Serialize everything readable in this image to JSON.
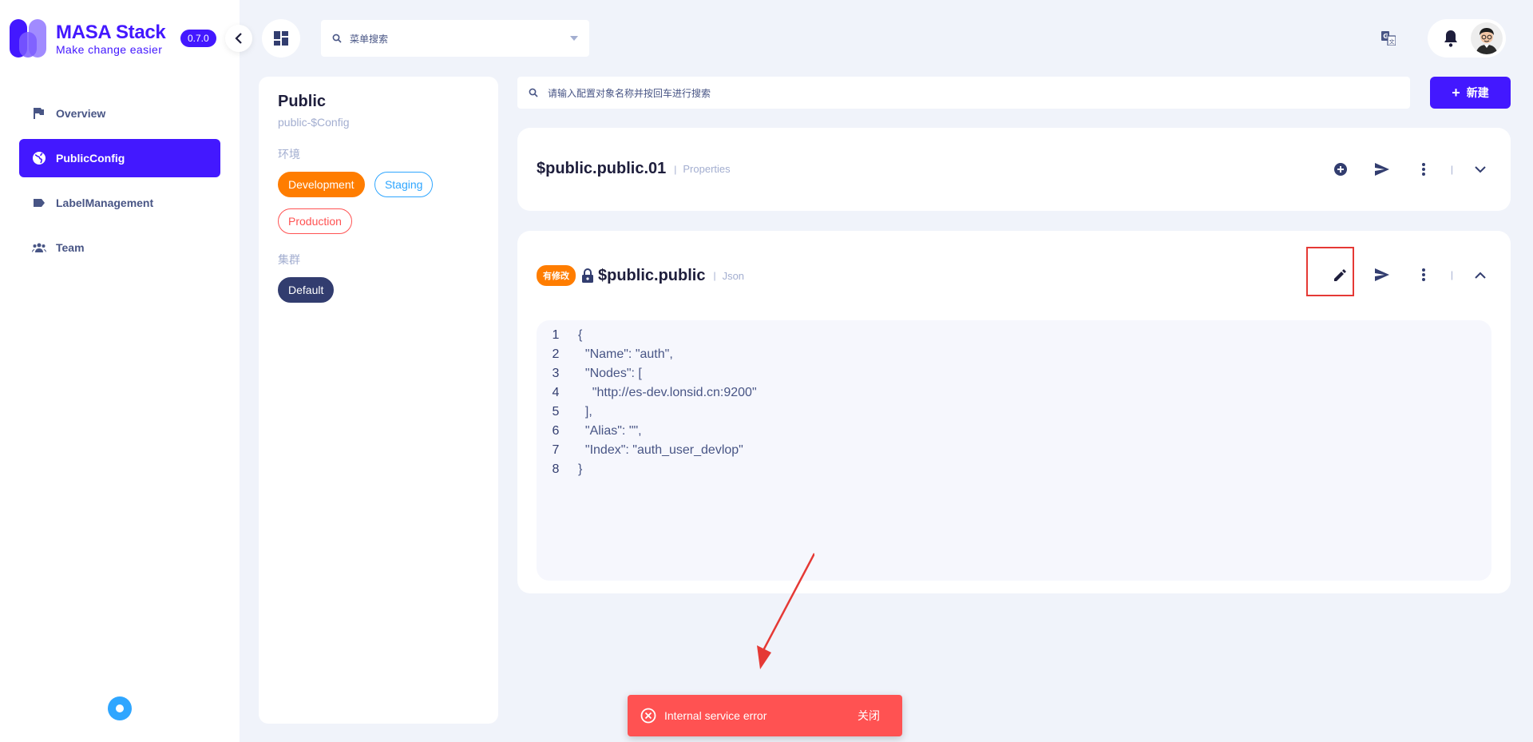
{
  "brand": {
    "title": "MASA Stack",
    "subtitle": "Make change easier",
    "version": "0.7.0",
    "color": "#4318FF"
  },
  "sidebar": {
    "items": [
      {
        "label": "Overview",
        "icon": "flag-icon",
        "active": false
      },
      {
        "label": "PublicConfig",
        "icon": "globe-icon",
        "active": true
      },
      {
        "label": "LabelManagement",
        "icon": "label-icon",
        "active": false
      },
      {
        "label": "Team",
        "icon": "team-icon",
        "active": false
      }
    ]
  },
  "topbar": {
    "menu_search_placeholder": "菜单搜索"
  },
  "panel": {
    "title": "Public",
    "subtitle": "public-$Config",
    "env_label": "环境",
    "envs": [
      "Development",
      "Staging",
      "Production"
    ],
    "cluster_label": "集群",
    "clusters": [
      "Default"
    ]
  },
  "config_search_placeholder": "请输入配置对象名称并按回车进行搜索",
  "new_button": {
    "plus": "+",
    "label": "新建"
  },
  "configs": [
    {
      "name": "$public.public.01",
      "type": "Properties"
    },
    {
      "badge": "有修改",
      "name": "$public.public",
      "type": "Json",
      "lines": [
        {
          "n": "1",
          "text": "{"
        },
        {
          "n": "2",
          "text": "  \"Name\": \"auth\","
        },
        {
          "n": "3",
          "text": "  \"Nodes\": ["
        },
        {
          "n": "4",
          "text": "    \"http://es-dev.lonsid.cn:9200\""
        },
        {
          "n": "5",
          "text": "  ],"
        },
        {
          "n": "6",
          "text": "  \"Alias\": \"\","
        },
        {
          "n": "7",
          "text": "  \"Index\": \"auth_user_devlop\""
        },
        {
          "n": "8",
          "text": "}"
        }
      ]
    }
  ],
  "separator": "|",
  "toast": {
    "message": "Internal service error",
    "close_label": "关闭",
    "color": "#FF5252"
  }
}
